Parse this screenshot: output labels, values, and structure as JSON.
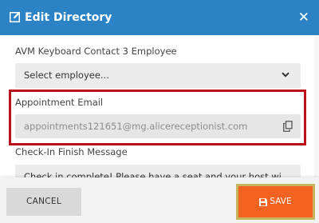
{
  "dialog": {
    "title": "Edit Directory",
    "close_glyph": "✕",
    "icons": {
      "title": "edit-icon",
      "close": "close-icon"
    }
  },
  "fields": {
    "keyboard_contact": {
      "label": "AVM Keyboard Contact 3 Employee",
      "selected": "Select employee...",
      "icon": "chevron-down-icon"
    },
    "appointment_email": {
      "label": "Appointment Email",
      "value": "appointments121651@mg.alicereceptionist.com",
      "icon": "copy-icon",
      "highlighted": true
    },
    "checkin_finish_message": {
      "label": "Check-In Finish Message",
      "value": "Check in complete! Please have a seat and your host will be out shortly."
    }
  },
  "footer": {
    "cancel_label": "CANCEL",
    "save_label": "SAVE",
    "save_icon": "floppy-disk-icon"
  },
  "colors": {
    "header": "#2b83c6",
    "highlight_border": "#b9121b",
    "save_button": "#f26322",
    "save_button_focus_ring": "#c7b45c",
    "cancel_button": "#d9d9d9"
  }
}
